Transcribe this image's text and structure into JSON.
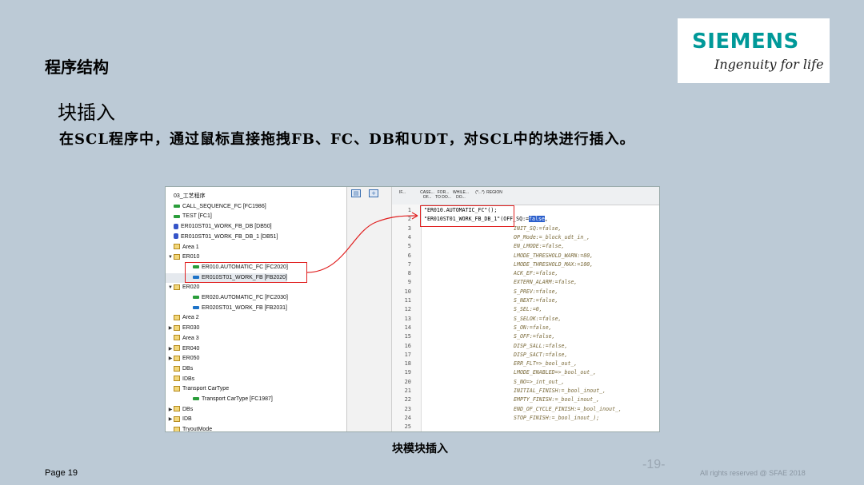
{
  "slide": {
    "section_title": "程序结构",
    "heading": "块插入",
    "subheading": "在SCL程序中，通过鼠标直接拖拽FB、FC、DB和UDT，对SCL中的块进行插入。",
    "caption": "块模块插入",
    "page_label": "Page 19",
    "page_number": "-19-",
    "rights": "All rights reserved @ SFAE 2018"
  },
  "logo": {
    "word": "SIEMENS",
    "tagline": "Ingenuity for life",
    "color": "#009999"
  },
  "tree": {
    "items": [
      {
        "label": "03_工艺程序",
        "icon": "none",
        "twisty": ""
      },
      {
        "label": "CALL_SEQUENCE_FC [FC1986]",
        "icon": "fc",
        "twisty": ""
      },
      {
        "label": "TEST [FC1]",
        "icon": "fc",
        "twisty": ""
      },
      {
        "label": "ER010ST01_WORK_FB_DB [DB50]",
        "icon": "db",
        "twisty": ""
      },
      {
        "label": "ER010ST01_WORK_FB_DB_1 [DB51]",
        "icon": "db",
        "twisty": ""
      },
      {
        "label": "Area 1",
        "icon": "folder",
        "twisty": ""
      },
      {
        "label": "ER010",
        "icon": "folder",
        "twisty": "▼"
      },
      {
        "label": "ER010.AUTOMATIC_FC [FC2020]",
        "icon": "fc",
        "twisty": "",
        "indent": 2
      },
      {
        "label": "ER010ST01_WORK_FB [FB2020]",
        "icon": "fb",
        "twisty": "",
        "indent": 2,
        "selected": true
      },
      {
        "label": "ER020",
        "icon": "folder",
        "twisty": "▼"
      },
      {
        "label": "ER020.AUTOMATIC_FC [FC2030]",
        "icon": "fc",
        "twisty": "",
        "indent": 2
      },
      {
        "label": "ER020ST01_WORK_FB [FB2031]",
        "icon": "fb",
        "twisty": "",
        "indent": 2
      },
      {
        "label": "Area 2",
        "icon": "folder",
        "twisty": ""
      },
      {
        "label": "ER030",
        "icon": "folder",
        "twisty": "▶"
      },
      {
        "label": "Area 3",
        "icon": "folder",
        "twisty": ""
      },
      {
        "label": "ER040",
        "icon": "folder",
        "twisty": "▶"
      },
      {
        "label": "ER050",
        "icon": "folder",
        "twisty": "▶"
      },
      {
        "label": "DBs",
        "icon": "folder",
        "twisty": ""
      },
      {
        "label": "IDBs",
        "icon": "folder",
        "twisty": ""
      },
      {
        "label": "Transport CarType",
        "icon": "folder",
        "twisty": ""
      },
      {
        "label": "Transport CarType [FC1987]",
        "icon": "fc",
        "twisty": "",
        "indent": 2
      },
      {
        "label": "DBs",
        "icon": "folder",
        "twisty": "▶"
      },
      {
        "label": "IDB",
        "icon": "folder",
        "twisty": "▶"
      },
      {
        "label": "TryoutMode",
        "icon": "folder",
        "twisty": ""
      }
    ]
  },
  "editor": {
    "toolbar": [
      "IF...",
      "CASE... OF...",
      "FOR... TO DO...",
      "WHILE... DO...",
      "(*...*)",
      "REGION"
    ],
    "lines": [
      {
        "n": "1",
        "text": "\"ER010.AUTOMATIC_FC\"();",
        "block": true
      },
      {
        "n": "2",
        "text": "\"ER010ST01_WORK_FB_DB_1\"(OFF_SQ:=",
        "block": true,
        "hl": "false",
        "tail": ","
      },
      {
        "n": "3",
        "text": "INIT_SQ:=false,"
      },
      {
        "n": "4",
        "text": "OP_Mode:=_block_udt_in_,"
      },
      {
        "n": "5",
        "text": "EN_LMODE:=false,"
      },
      {
        "n": "6",
        "text": "LMODE_THRESHOLD_WARN:=80,"
      },
      {
        "n": "7",
        "text": "LMODE_THRESHOLD_MAX:=100,"
      },
      {
        "n": "8",
        "text": "ACK_EF:=false,"
      },
      {
        "n": "9",
        "text": "EXTERN_ALARM:=false,"
      },
      {
        "n": "10",
        "text": "S_PREV:=false,"
      },
      {
        "n": "11",
        "text": "S_NEXT:=false,"
      },
      {
        "n": "12",
        "text": "S_SEL:=0,"
      },
      {
        "n": "13",
        "text": "S_SELOK:=false,"
      },
      {
        "n": "14",
        "text": "S_ON:=false,"
      },
      {
        "n": "15",
        "text": "S_OFF:=false,"
      },
      {
        "n": "16",
        "text": "DISP_SALL:=false,"
      },
      {
        "n": "17",
        "text": "DISP_SACT:=false,"
      },
      {
        "n": "18",
        "text": "ERR_FLT=>_bool_out_,"
      },
      {
        "n": "19",
        "text": "LMODE_ENABLED=>_bool_out_,"
      },
      {
        "n": "20",
        "text": "S_NO=>_int_out_,"
      },
      {
        "n": "21",
        "text": "INITIAL_FINISH:=_bool_inout_,"
      },
      {
        "n": "22",
        "text": "EMPTY_FINISH:=_bool_inout_,"
      },
      {
        "n": "23",
        "text": "END_OF_CYCLE_FINISH:=_bool_inout_,"
      },
      {
        "n": "24",
        "text": "STOP_FINISH:=_bool_inout_);"
      },
      {
        "n": "25",
        "text": ""
      }
    ]
  }
}
